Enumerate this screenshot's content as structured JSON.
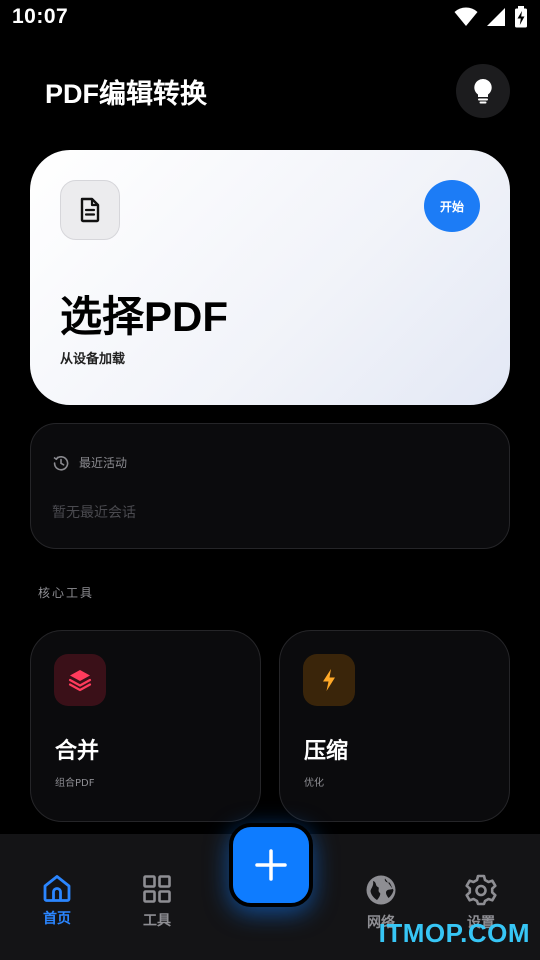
{
  "status_bar": {
    "time": "10:07",
    "icons": [
      "wifi-icon",
      "signal-icon",
      "battery-charging-icon"
    ]
  },
  "header": {
    "title": "PDF编辑转换",
    "tip_icon": "lightbulb-icon"
  },
  "hero": {
    "icon": "document-icon",
    "start_label": "开始",
    "title": "选择PDF",
    "subtitle": "从设备加载",
    "accent": "#1c7cf6"
  },
  "recent": {
    "icon": "history-icon",
    "label": "最近活动",
    "empty_text": "暂无最近会话"
  },
  "tools_section": {
    "label": "核心工具",
    "items": [
      {
        "title": "合并",
        "subtitle": "组合PDF",
        "icon": "layers-icon",
        "color": "#ff3b5c"
      },
      {
        "title": "压缩",
        "subtitle": "优化",
        "icon": "lightning-icon",
        "color": "#ffa928"
      }
    ]
  },
  "bottom_nav": {
    "items": [
      {
        "label": "首页",
        "icon": "home-icon",
        "active": true
      },
      {
        "label": "工具",
        "icon": "grid-icon",
        "active": false
      },
      {
        "label": "网络",
        "icon": "globe-icon",
        "active": false
      },
      {
        "label": "设置",
        "icon": "gear-icon",
        "active": false
      }
    ],
    "fab_icon": "plus-icon",
    "active_color": "#2b86ff"
  },
  "watermark": "ITMOP.COM"
}
